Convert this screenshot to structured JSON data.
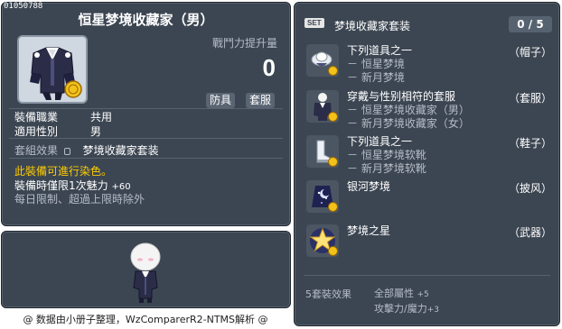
{
  "item": {
    "id": "01050788",
    "title": "恒星梦境收藏家（男）",
    "power_label": "戰鬥力提升量",
    "power_value": "0",
    "tags": [
      "防具",
      "套服"
    ],
    "stats": [
      {
        "k": "裝備職業",
        "v": "共用"
      },
      {
        "k": "適用性別",
        "v": "男"
      }
    ],
    "set_effect_label": "套組效果",
    "set_effect_value": "梦境收藏家套装",
    "dye_note": "此裝備可進行染色。",
    "charm_text": "裝備時僅限1次魅力",
    "charm_value": "+60",
    "limit_note": "每日限制、超過上限時除外"
  },
  "footer": "@ 数据由小册子整理，WzComparerR2-NTMS解析 @",
  "set": {
    "badge": "SET",
    "title": "梦境收藏家套装",
    "count": "0 / 5",
    "items": [
      {
        "icon": "hat-icon",
        "lines": [
          "下列道具之一",
          "－ 恒星梦境",
          "－ 新月梦境"
        ],
        "slot": "（帽子）"
      },
      {
        "icon": "suit-icon",
        "lines": [
          "穿戴与性别相符的套服",
          "－ 恒星梦境收藏家（男）",
          "－ 新月梦境收藏家（女）"
        ],
        "slot": "（套服）"
      },
      {
        "icon": "shoes-icon",
        "lines": [
          "下列道具之一",
          "－ 恒星梦境软靴",
          "－ 新月梦境软靴"
        ],
        "slot": "（鞋子）"
      },
      {
        "icon": "cape-icon",
        "lines": [
          "银河梦境"
        ],
        "slot": "（披风）"
      },
      {
        "icon": "star-weapon-icon",
        "lines": [
          "梦境之星"
        ],
        "slot": "（武器）"
      }
    ],
    "bonus_label": "5套裝效果",
    "bonus_lines": [
      {
        "text": "全部屬性",
        "value": "+5"
      },
      {
        "text": "攻擊力/魔力",
        "value": "+3"
      }
    ]
  },
  "colors": {
    "panel_bg": "#3c4652",
    "dye_note": "#ffcc00",
    "sub_text": "#b5bcc6"
  }
}
